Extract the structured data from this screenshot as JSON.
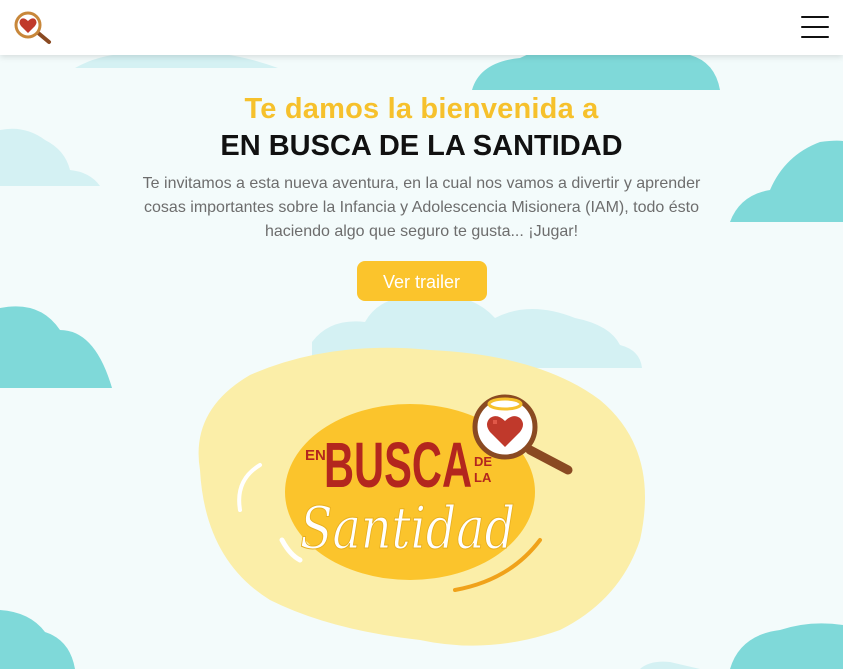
{
  "header": {
    "logo_icon": "heart-magnifier-icon",
    "menu_icon": "hamburger-menu-icon"
  },
  "hero": {
    "welcome": "Te damos la bienvenida a",
    "title": "EN BUSCA DE LA SANTIDAD",
    "description": "Te invitamos a esta nueva aventura, en la cual nos vamos a divertir y aprender cosas importantes sobre la Infancia y Adolescencia Misionera (IAM), todo ésto haciendo algo que seguro te gusta... ¡Jugar!",
    "trailer_button": "Ver trailer"
  },
  "game_logo": {
    "en": "EN",
    "busca": "BUSCA",
    "de": "DE",
    "la": "LA",
    "santidad": "Santidad"
  },
  "colors": {
    "accent": "#f6c12c",
    "cloud": "#7fd9d9",
    "cloud_light": "#d4f1f3",
    "background": "#f3fbfb",
    "blob": "#fbeea8",
    "text_dark": "#111111",
    "text_muted": "#6d6d6d",
    "logo_red": "#b3261e"
  }
}
